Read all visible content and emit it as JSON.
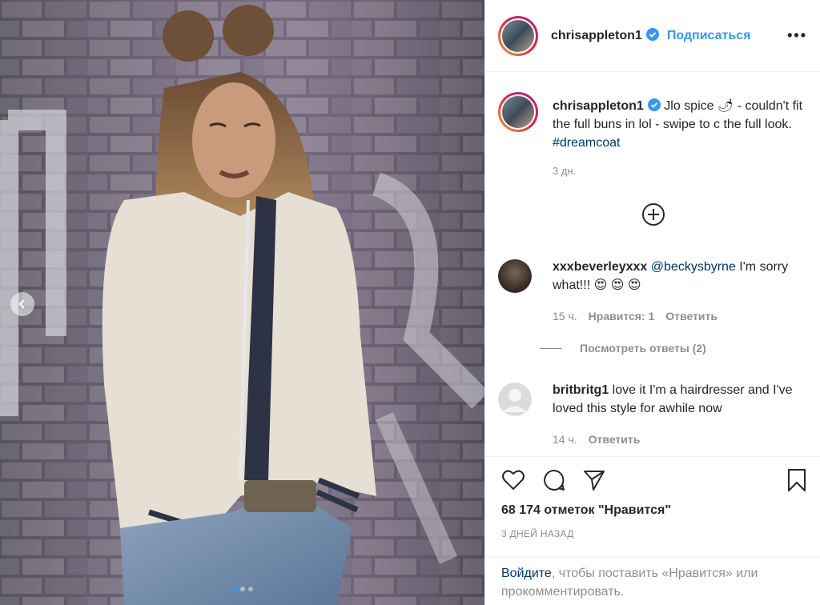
{
  "post": {
    "username": "chrisappleton1",
    "follow_label": "Подписаться",
    "more_label": "•••",
    "caption_main": "Jlo spice 🌶 - couldn't fit the full buns in lol - swipe to c the full look. ",
    "caption_hashtag": "#dreamcoat",
    "caption_time": "3 дн.",
    "carousel_dots": 3
  },
  "comments": [
    {
      "username": "xxxbeverleyxxx",
      "mention": "@beckysbyrne",
      "text": " I'm sorry what!!! 😍 😍 😍",
      "time": "15 ч.",
      "likes": "Нравится: 1",
      "reply": "Ответить",
      "view_replies": "Посмотреть ответы (2)"
    },
    {
      "username": "britbritg1",
      "text": " love it I'm a hairdresser and I've loved this style for awhile now",
      "time": "14 ч.",
      "reply": "Ответить"
    }
  ],
  "actions": {
    "likes_count": "68 174 отметок \"Нравится\"",
    "date": "3 ДНЕЙ НАЗАД",
    "login_link": "Войдите",
    "login_text": ", чтобы поставить «Нравится» или прокомментировать."
  },
  "colors": {
    "accent": "#3897f0",
    "link": "#00376b",
    "muted": "#8e8e8e",
    "text": "#262626"
  },
  "icons": {
    "verified": "verified-badge-icon",
    "like": "heart-icon",
    "comment": "comment-bubble-icon",
    "share": "paper-plane-icon",
    "save": "bookmark-icon",
    "load_more": "plus-circle-icon",
    "carousel_prev": "chevron-left-icon"
  }
}
